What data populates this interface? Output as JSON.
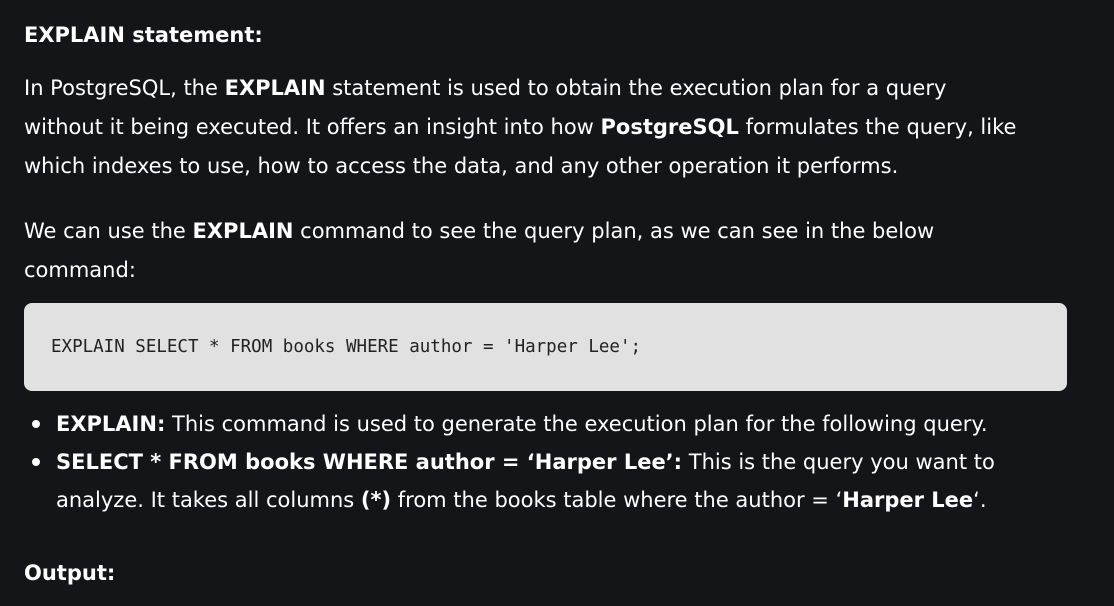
{
  "heading": "EXPLAIN statement:",
  "para1": {
    "l1_a": "In PostgreSQL, the ",
    "l1_b": "EXPLAIN",
    "l1_c": " statement is used to obtain the execution plan for a query",
    "l2_a": "without it being executed. It offers an insight into how ",
    "l2_b": "PostgreSQL",
    "l2_c": " formulates the query, like",
    "l3": "which indexes to use, how to access the data, and any other operation it performs."
  },
  "para2": {
    "l1_a": "We can use the ",
    "l1_b": "EXPLAIN",
    "l1_c": " command to see the query plan, as we can see in the below",
    "l2": "command:"
  },
  "code": "EXPLAIN SELECT * FROM books WHERE author = 'Harper Lee';",
  "bullets": [
    {
      "term": "EXPLAIN:",
      "text": " This command is used to generate the execution plan for the following query."
    },
    {
      "term": "SELECT * FROM books WHERE author = ‘Harper Lee’:",
      "text": " This is the query you want to",
      "l2_a": "analyze. It takes all columns ",
      "l2_b": "(*)",
      "l2_c": " from the books table where the author = ‘",
      "l2_d": "Harper Lee",
      "l2_e": "‘."
    }
  ],
  "output_heading": "Output:"
}
